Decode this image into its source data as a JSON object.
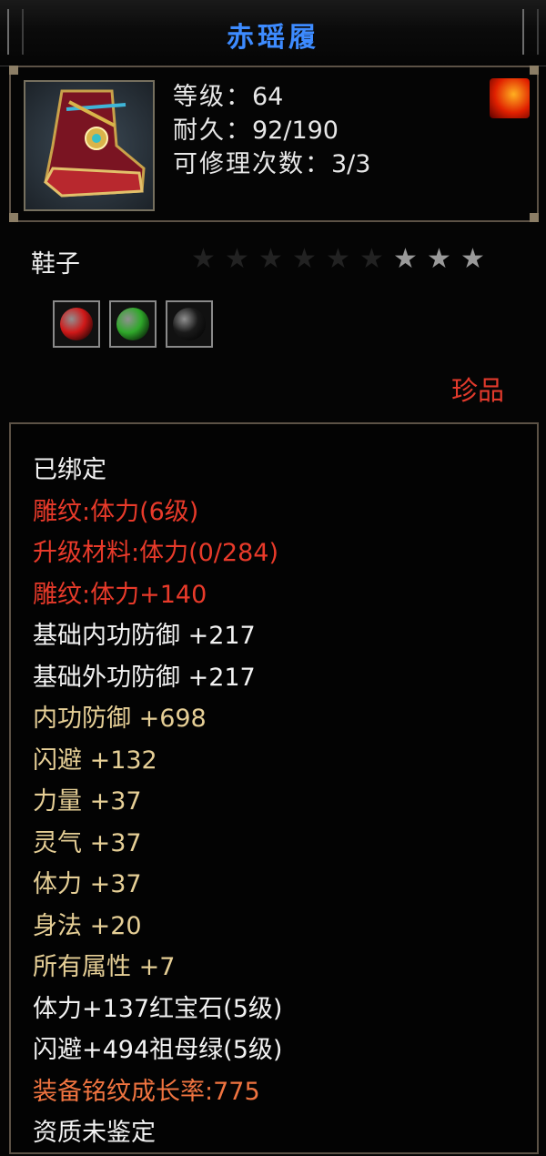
{
  "title": "赤瑶履",
  "icon": "boots-icon",
  "fire_badge": "fire-emblem-icon",
  "info": {
    "level_label": "等级：",
    "level": "64",
    "durability_label": "耐久：",
    "durability": "92/190",
    "repair_label": "可修理次数：",
    "repair": "3/3"
  },
  "type": "鞋子",
  "stars": {
    "total": 9,
    "filled": 3
  },
  "gems": [
    {
      "name": "ruby-gem-icon",
      "color": "#d01818"
    },
    {
      "name": "emerald-gem-icon",
      "color": "#2fa82a"
    },
    {
      "name": "empty-gem-slot-icon",
      "color": "#1a1a1a"
    }
  ],
  "quality": "珍品",
  "stats": [
    {
      "text": "已绑定",
      "color": "white"
    },
    {
      "text": "雕纹:体力(6级)",
      "color": "red"
    },
    {
      "text": "升级材料:体力(0/284)",
      "color": "red"
    },
    {
      "text": "雕纹:体力+140",
      "color": "red"
    },
    {
      "text": "基础内功防御 +217",
      "color": "white"
    },
    {
      "text": "基础外功防御 +217",
      "color": "white"
    },
    {
      "text": "内功防御 +698",
      "color": "gold"
    },
    {
      "text": "闪避 +132",
      "color": "gold"
    },
    {
      "text": "力量 +37",
      "color": "gold"
    },
    {
      "text": "灵气 +37",
      "color": "gold"
    },
    {
      "text": "体力 +37",
      "color": "gold"
    },
    {
      "text": "身法 +20",
      "color": "gold"
    },
    {
      "text": "所有属性 +7",
      "color": "gold"
    },
    {
      "text": "体力+137红宝石(5级)",
      "color": "white"
    },
    {
      "text": "闪避+494祖母绿(5级)",
      "color": "white"
    },
    {
      "text": "装备铭纹成长率:775",
      "color": "orange"
    },
    {
      "text": "资质未鉴定",
      "color": "white"
    }
  ],
  "colors": {
    "title": "#3d8bff",
    "quality": "#e23a2c",
    "star_filled": "#9a9a9a",
    "star_empty": "#222222"
  }
}
